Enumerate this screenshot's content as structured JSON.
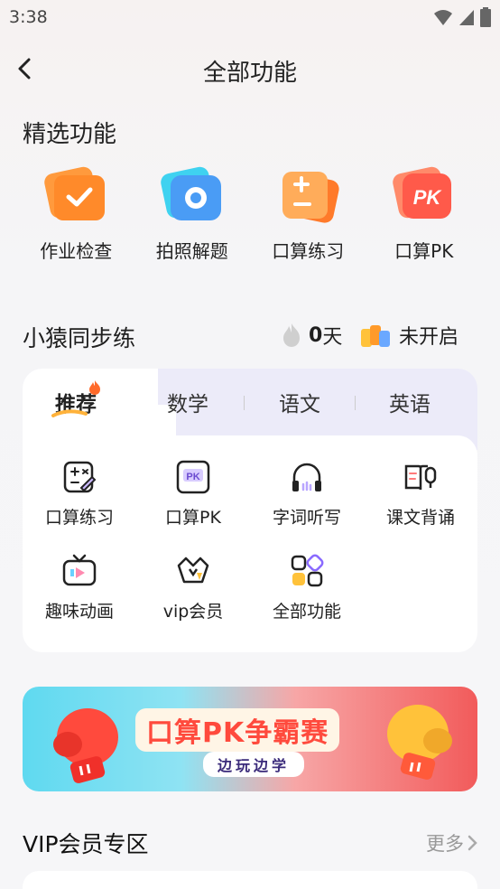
{
  "status": {
    "time": "3:38"
  },
  "header": {
    "title": "全部功能"
  },
  "featured": {
    "title": "精选功能",
    "items": [
      {
        "label": "作业检查",
        "icon": "homework-check-icon"
      },
      {
        "label": "拍照解题",
        "icon": "camera-icon"
      },
      {
        "label": "口算练习",
        "icon": "calc-practice-icon"
      },
      {
        "label": "口算PK",
        "icon": "pk-icon"
      }
    ]
  },
  "sync": {
    "title": "小猿同步练",
    "streak_value": "0",
    "streak_unit": "天",
    "status": "未开启"
  },
  "tabs": [
    "推荐",
    "数学",
    "语文",
    "英语"
  ],
  "grid": [
    {
      "label": "口算练习",
      "icon": "calc-icon"
    },
    {
      "label": "口算PK",
      "icon": "pk-icon"
    },
    {
      "label": "字词听写",
      "icon": "headphones-icon"
    },
    {
      "label": "课文背诵",
      "icon": "book-mic-icon"
    },
    {
      "label": "趣味动画",
      "icon": "tv-play-icon"
    },
    {
      "label": "vip会员",
      "icon": "vip-crown-icon"
    },
    {
      "label": "全部功能",
      "icon": "all-apps-icon"
    }
  ],
  "banner": {
    "title": "口算PK争霸赛",
    "subtitle": "边玩边学"
  },
  "vip": {
    "title": "VIP会员专区",
    "more": "更多"
  },
  "colors": {
    "accent": "#ff6a2a",
    "tab_bg": "#ecebf9",
    "banner_red": "#f25b5b",
    "banner_cyan": "#5fd9f0"
  }
}
